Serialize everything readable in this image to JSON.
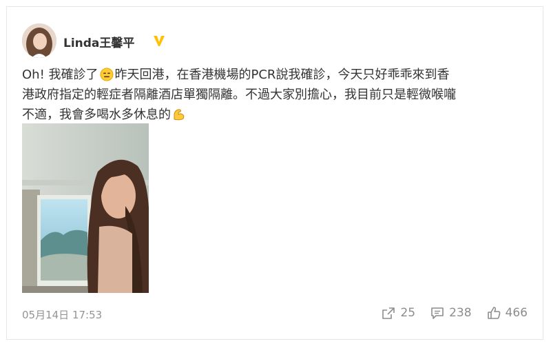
{
  "post": {
    "user": {
      "name": "Linda王馨平",
      "avatar_icon": "avatar-photo",
      "verified_icon": "verified-badge-icon",
      "verified_color": "#ffc107"
    },
    "text_lines": [
      [
        "Oh! 我確診了",
        "昨天回港，在香港機場的PCR說我確診，今天只好乖乖來到香"
      ],
      [
        "港政府指定的輕症者隔離酒店單獨隔離。不過大家別擔心，我目前只是輕微喉嚨"
      ],
      [
        "不適，我會多喝水多休息的"
      ]
    ],
    "emojis": [
      "expressionless-face-emoji",
      "flexed-biceps-emoji"
    ],
    "photo_icon": "selfie-photo",
    "timestamp": "05月14日 17:53",
    "actions": {
      "share_count": "25",
      "comment_count": "238",
      "like_count": "466"
    }
  }
}
